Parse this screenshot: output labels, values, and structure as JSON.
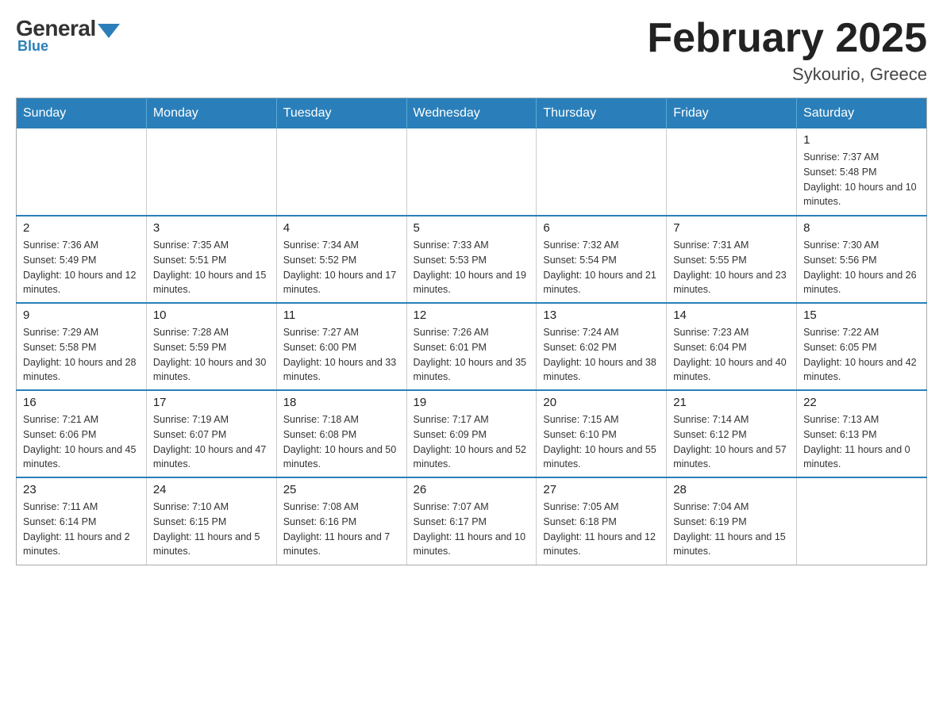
{
  "header": {
    "logo": {
      "general": "General",
      "blue": "Blue",
      "arrow": "▼"
    },
    "title": "February 2025",
    "location": "Sykourio, Greece"
  },
  "calendar": {
    "days_of_week": [
      "Sunday",
      "Monday",
      "Tuesday",
      "Wednesday",
      "Thursday",
      "Friday",
      "Saturday"
    ],
    "weeks": [
      [
        {
          "day": "",
          "sunrise": "",
          "sunset": "",
          "daylight": ""
        },
        {
          "day": "",
          "sunrise": "",
          "sunset": "",
          "daylight": ""
        },
        {
          "day": "",
          "sunrise": "",
          "sunset": "",
          "daylight": ""
        },
        {
          "day": "",
          "sunrise": "",
          "sunset": "",
          "daylight": ""
        },
        {
          "day": "",
          "sunrise": "",
          "sunset": "",
          "daylight": ""
        },
        {
          "day": "",
          "sunrise": "",
          "sunset": "",
          "daylight": ""
        },
        {
          "day": "1",
          "sunrise": "Sunrise: 7:37 AM",
          "sunset": "Sunset: 5:48 PM",
          "daylight": "Daylight: 10 hours and 10 minutes."
        }
      ],
      [
        {
          "day": "2",
          "sunrise": "Sunrise: 7:36 AM",
          "sunset": "Sunset: 5:49 PM",
          "daylight": "Daylight: 10 hours and 12 minutes."
        },
        {
          "day": "3",
          "sunrise": "Sunrise: 7:35 AM",
          "sunset": "Sunset: 5:51 PM",
          "daylight": "Daylight: 10 hours and 15 minutes."
        },
        {
          "day": "4",
          "sunrise": "Sunrise: 7:34 AM",
          "sunset": "Sunset: 5:52 PM",
          "daylight": "Daylight: 10 hours and 17 minutes."
        },
        {
          "day": "5",
          "sunrise": "Sunrise: 7:33 AM",
          "sunset": "Sunset: 5:53 PM",
          "daylight": "Daylight: 10 hours and 19 minutes."
        },
        {
          "day": "6",
          "sunrise": "Sunrise: 7:32 AM",
          "sunset": "Sunset: 5:54 PM",
          "daylight": "Daylight: 10 hours and 21 minutes."
        },
        {
          "day": "7",
          "sunrise": "Sunrise: 7:31 AM",
          "sunset": "Sunset: 5:55 PM",
          "daylight": "Daylight: 10 hours and 23 minutes."
        },
        {
          "day": "8",
          "sunrise": "Sunrise: 7:30 AM",
          "sunset": "Sunset: 5:56 PM",
          "daylight": "Daylight: 10 hours and 26 minutes."
        }
      ],
      [
        {
          "day": "9",
          "sunrise": "Sunrise: 7:29 AM",
          "sunset": "Sunset: 5:58 PM",
          "daylight": "Daylight: 10 hours and 28 minutes."
        },
        {
          "day": "10",
          "sunrise": "Sunrise: 7:28 AM",
          "sunset": "Sunset: 5:59 PM",
          "daylight": "Daylight: 10 hours and 30 minutes."
        },
        {
          "day": "11",
          "sunrise": "Sunrise: 7:27 AM",
          "sunset": "Sunset: 6:00 PM",
          "daylight": "Daylight: 10 hours and 33 minutes."
        },
        {
          "day": "12",
          "sunrise": "Sunrise: 7:26 AM",
          "sunset": "Sunset: 6:01 PM",
          "daylight": "Daylight: 10 hours and 35 minutes."
        },
        {
          "day": "13",
          "sunrise": "Sunrise: 7:24 AM",
          "sunset": "Sunset: 6:02 PM",
          "daylight": "Daylight: 10 hours and 38 minutes."
        },
        {
          "day": "14",
          "sunrise": "Sunrise: 7:23 AM",
          "sunset": "Sunset: 6:04 PM",
          "daylight": "Daylight: 10 hours and 40 minutes."
        },
        {
          "day": "15",
          "sunrise": "Sunrise: 7:22 AM",
          "sunset": "Sunset: 6:05 PM",
          "daylight": "Daylight: 10 hours and 42 minutes."
        }
      ],
      [
        {
          "day": "16",
          "sunrise": "Sunrise: 7:21 AM",
          "sunset": "Sunset: 6:06 PM",
          "daylight": "Daylight: 10 hours and 45 minutes."
        },
        {
          "day": "17",
          "sunrise": "Sunrise: 7:19 AM",
          "sunset": "Sunset: 6:07 PM",
          "daylight": "Daylight: 10 hours and 47 minutes."
        },
        {
          "day": "18",
          "sunrise": "Sunrise: 7:18 AM",
          "sunset": "Sunset: 6:08 PM",
          "daylight": "Daylight: 10 hours and 50 minutes."
        },
        {
          "day": "19",
          "sunrise": "Sunrise: 7:17 AM",
          "sunset": "Sunset: 6:09 PM",
          "daylight": "Daylight: 10 hours and 52 minutes."
        },
        {
          "day": "20",
          "sunrise": "Sunrise: 7:15 AM",
          "sunset": "Sunset: 6:10 PM",
          "daylight": "Daylight: 10 hours and 55 minutes."
        },
        {
          "day": "21",
          "sunrise": "Sunrise: 7:14 AM",
          "sunset": "Sunset: 6:12 PM",
          "daylight": "Daylight: 10 hours and 57 minutes."
        },
        {
          "day": "22",
          "sunrise": "Sunrise: 7:13 AM",
          "sunset": "Sunset: 6:13 PM",
          "daylight": "Daylight: 11 hours and 0 minutes."
        }
      ],
      [
        {
          "day": "23",
          "sunrise": "Sunrise: 7:11 AM",
          "sunset": "Sunset: 6:14 PM",
          "daylight": "Daylight: 11 hours and 2 minutes."
        },
        {
          "day": "24",
          "sunrise": "Sunrise: 7:10 AM",
          "sunset": "Sunset: 6:15 PM",
          "daylight": "Daylight: 11 hours and 5 minutes."
        },
        {
          "day": "25",
          "sunrise": "Sunrise: 7:08 AM",
          "sunset": "Sunset: 6:16 PM",
          "daylight": "Daylight: 11 hours and 7 minutes."
        },
        {
          "day": "26",
          "sunrise": "Sunrise: 7:07 AM",
          "sunset": "Sunset: 6:17 PM",
          "daylight": "Daylight: 11 hours and 10 minutes."
        },
        {
          "day": "27",
          "sunrise": "Sunrise: 7:05 AM",
          "sunset": "Sunset: 6:18 PM",
          "daylight": "Daylight: 11 hours and 12 minutes."
        },
        {
          "day": "28",
          "sunrise": "Sunrise: 7:04 AM",
          "sunset": "Sunset: 6:19 PM",
          "daylight": "Daylight: 11 hours and 15 minutes."
        },
        {
          "day": "",
          "sunrise": "",
          "sunset": "",
          "daylight": ""
        }
      ]
    ]
  }
}
